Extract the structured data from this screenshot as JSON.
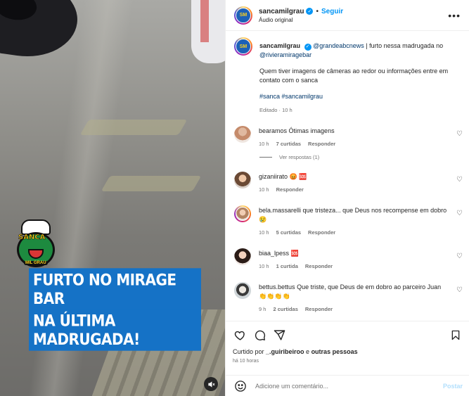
{
  "media": {
    "logo_top": "SANCA",
    "logo_bottom": "MIL GRAU",
    "banner_line1": "FURTO NO MIRAGE BAR",
    "banner_line2": "NA ÚLTIMA MADRUGADA!"
  },
  "header": {
    "username": "sancamilgrau",
    "follow_label": "Seguir",
    "audio_label": "Áudio original",
    "more_label": "•••"
  },
  "caption": {
    "username": "sancamilgrau",
    "mention1": "@grandeabcnews",
    "text1": " | furto nessa madrugada no ",
    "mention2": "@rivieramiragebar",
    "paragraph": "Quem tiver imagens de câmeras ao redor ou informações entre em contato com o sanca",
    "hashtags": "#sanca #sancamilgrau",
    "meta": "Editado · 10 h"
  },
  "comments": [
    {
      "username": "bearamos",
      "text": "Ótimas imagens",
      "time": "10 h",
      "likes": "7 curtidas",
      "reply_label": "Responder",
      "view_replies": "Ver respostas (1)"
    },
    {
      "username": "gizaniirato",
      "text": "😡 🆘",
      "time": "10 h",
      "likes": "",
      "reply_label": "Responder"
    },
    {
      "username": "bela.massarelli",
      "text": "que tristeza... que Deus nos recompense em dobro 😢",
      "time": "10 h",
      "likes": "5 curtidas",
      "reply_label": "Responder"
    },
    {
      "username": "biaa_lpess",
      "text": "🆘",
      "time": "10 h",
      "likes": "1 curtida",
      "reply_label": "Responder"
    },
    {
      "username": "bettus.bettus",
      "text": "Que triste, que Deus de em dobro ao parceiro Juan 👏👏👏👏",
      "time": "9 h",
      "likes": "2 curtidas",
      "reply_label": "Responder"
    }
  ],
  "footer": {
    "liked_prefix": "Curtido por ",
    "liked_user": "_.guiribeiroo",
    "liked_suffix": " e ",
    "liked_others": "outras pessoas",
    "time_ago": "há 10 horas",
    "comment_placeholder": "Adicione um comentário...",
    "post_label": "Postar"
  },
  "colors": {
    "accent": "#0095f6",
    "banner_bg": "#1572c6",
    "link": "#00376b",
    "muted": "#737373"
  }
}
